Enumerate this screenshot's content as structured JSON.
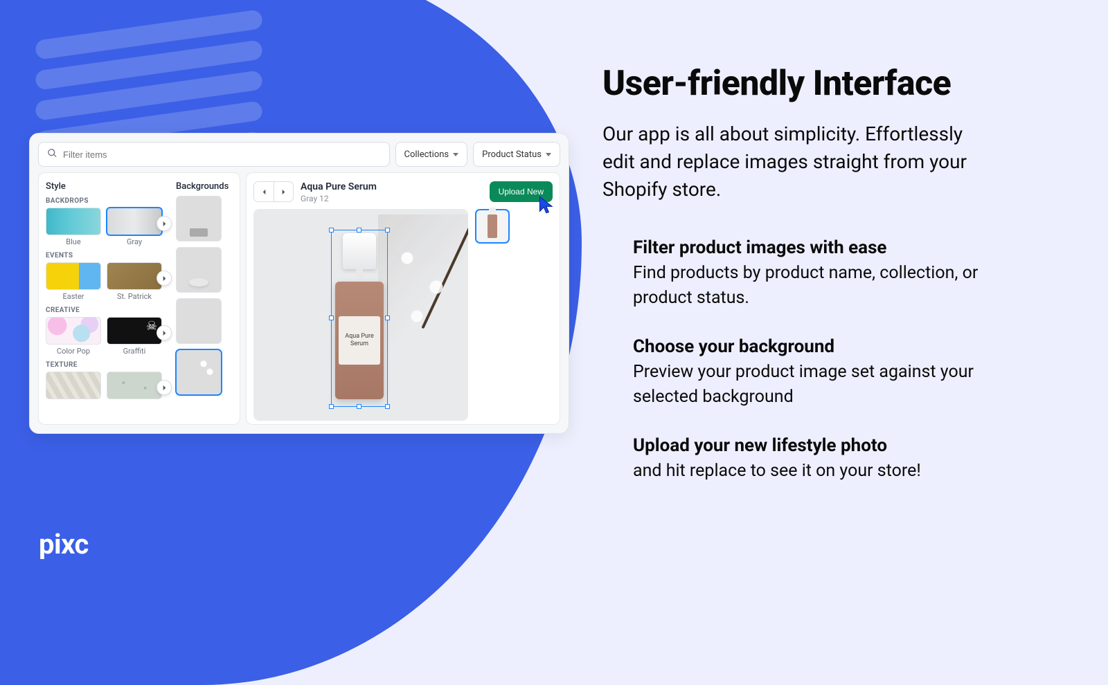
{
  "logo": "pixc",
  "copy": {
    "title": "User-friendly Interface",
    "lede": "Our app is all about simplicity. Effortlessly edit and replace images straight from your Shopify store.",
    "features": [
      {
        "title": "Filter product images with ease",
        "body": "Find products by product name, collection, or product status."
      },
      {
        "title": "Choose your background",
        "body": "Preview your product image set against your selected background"
      },
      {
        "title": "Upload your new lifestyle photo",
        "body": "and hit replace to see it on your store!"
      }
    ]
  },
  "app": {
    "search_placeholder": "Filter items",
    "select_collections": "Collections",
    "select_status": "Product Status",
    "panel_style": "Style",
    "panel_backgrounds": "Backgrounds",
    "groups": {
      "backdrops": {
        "label": "BACKDROPS",
        "t1": "Blue",
        "t2": "Gray"
      },
      "events": {
        "label": "EVENTS",
        "t1": "Easter",
        "t2": "St. Patrick"
      },
      "creative": {
        "label": "CREATIVE",
        "t1": "Color Pop",
        "t2": "Graffiti"
      },
      "texture": {
        "label": "TEXTURE"
      }
    },
    "product": {
      "name": "Aqua Pure Serum",
      "variant": "Gray 12",
      "label_text": "Aqua Pure Serum"
    },
    "upload_label": "Upload New"
  }
}
